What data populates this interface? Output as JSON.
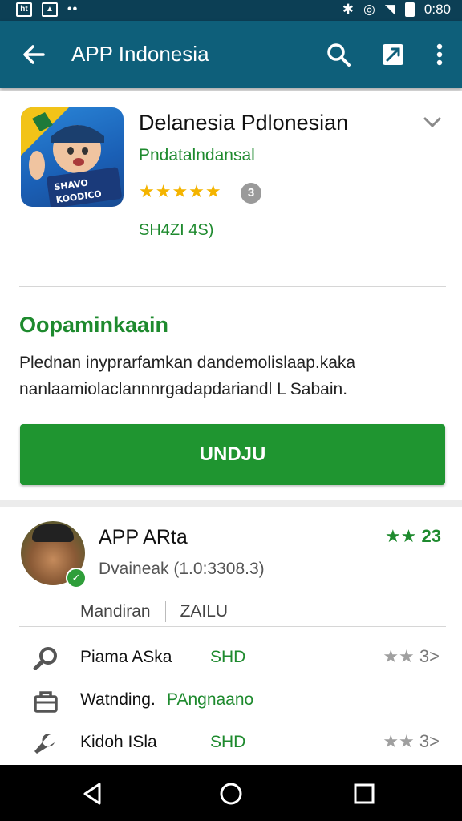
{
  "status_bar": {
    "time": "0:80"
  },
  "app_bar": {
    "title": "APP Indonesia"
  },
  "app": {
    "name": "Delanesia Pdlonesian",
    "developer": "Pndatalndansal",
    "stars": "★★★★★",
    "info": "3",
    "price": "SH4ZI 4S)",
    "icon_text_top": "SHAVO",
    "icon_text_bottom": "KOODICO"
  },
  "section": {
    "title": "Oopaminkaain",
    "description_line1": "Plednan inyprarfamkan dandemolislaap.kaka",
    "description_line2": "nanlaamiolaclannnrgadapdariandl L Sabain.",
    "install_label": "UNDJU"
  },
  "review": {
    "reviewer": "APP ARta",
    "meta": "Dvaineak  (1.0:3308.3)",
    "top_rating": "★★",
    "top_rating_count": "23",
    "tag1": "Mandiran",
    "tag2": "ZAILU",
    "rows": [
      {
        "label": "Piama ASka",
        "value": "SHD",
        "stars": "★★",
        "count": "3>"
      },
      {
        "label": "Watnding.",
        "value": "PAngnaano",
        "stars": "",
        "count": ""
      },
      {
        "label": "Kidoh ISla",
        "value": "SHD",
        "stars": "★★",
        "count": "3>"
      }
    ]
  },
  "colors": {
    "appbar": "#0e5f7a",
    "statusbar": "#0c3f55",
    "accent_green": "#1f9530",
    "star": "#f4b400"
  }
}
